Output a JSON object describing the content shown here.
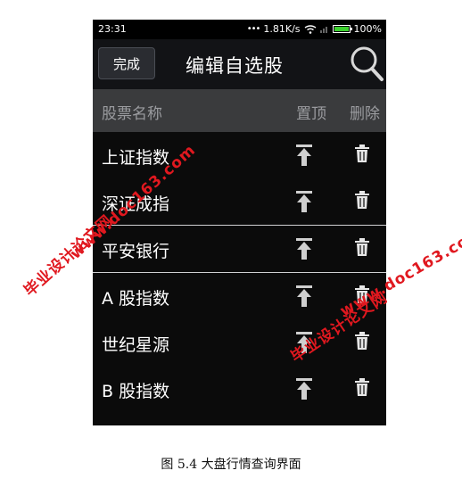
{
  "status_bar": {
    "time": "23:31",
    "net_speed": "1.81K/s",
    "battery": "100%"
  },
  "header": {
    "done_label": "完成",
    "title": "编辑自选股"
  },
  "columns": {
    "name": "股票名称",
    "pin": "置顶",
    "delete": "删除"
  },
  "stocks": [
    "上证指数",
    "深证成指",
    "平安银行",
    "A 股指数",
    "世纪星源",
    "B 股指数"
  ],
  "watermarks": {
    "site": "www.doc163.com",
    "brand": "毕业设计论文网"
  },
  "caption": "图 5.4 大盘行情查询界面",
  "colors": {
    "accent_green": "#3cd12e",
    "watermark_red": "#e0181f"
  }
}
